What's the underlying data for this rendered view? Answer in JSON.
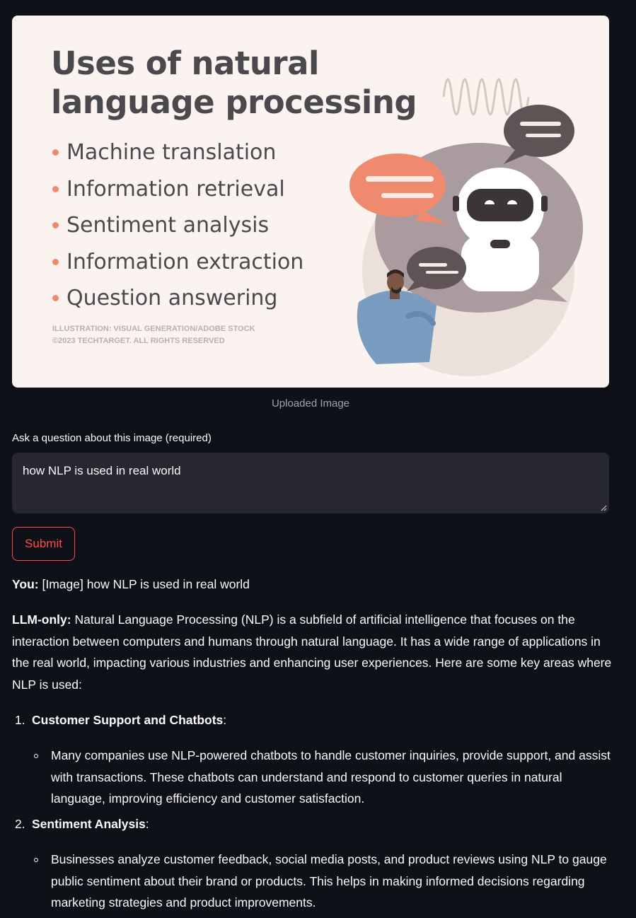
{
  "uploaded_image": {
    "title_line1": "Uses of natural",
    "title_line2": "language processing",
    "items": [
      "Machine translation",
      "Information retrieval",
      "Sentiment analysis",
      "Information extraction",
      "Question answering"
    ],
    "credit": "ILLUSTRATION: VISUAL GENERATION/ADOBE STOCK\n©2023 TECHTARGET. ALL RIGHTS RESERVED",
    "caption": "Uploaded Image"
  },
  "question": {
    "label": "Ask a question about this image (required)",
    "value": "how NLP is used in real world"
  },
  "submit_label": "Submit",
  "chat": {
    "user_label": "You:",
    "user_text": "[Image] how NLP is used in real world",
    "llm_label": "LLM-only:",
    "llm_intro": "Natural Language Processing (NLP) is a subfield of artificial intelligence that focuses on the interaction between computers and humans through natural language. It has a wide range of applications in the real world, impacting various industries and enhancing user experiences. Here are some key areas where NLP is used:",
    "points": [
      {
        "number": "1.",
        "heading": "Customer Support and Chatbots",
        "detail": "Many companies use NLP-powered chatbots to handle customer inquiries, provide support, and assist with transactions. These chatbots can understand and respond to customer queries in natural language, improving efficiency and customer satisfaction."
      },
      {
        "number": "2.",
        "heading": "Sentiment Analysis",
        "detail": "Businesses analyze customer feedback, social media posts, and product reviews using NLP to gauge public sentiment about their brand or products. This helps in making informed decisions regarding marketing strategies and product improvements."
      }
    ]
  },
  "colors": {
    "background": "#0e1117",
    "input_bg": "#262730",
    "accent": "#ff4b4b",
    "image_bg": "#fbf3ef",
    "bullet": "#ef8a6f"
  }
}
